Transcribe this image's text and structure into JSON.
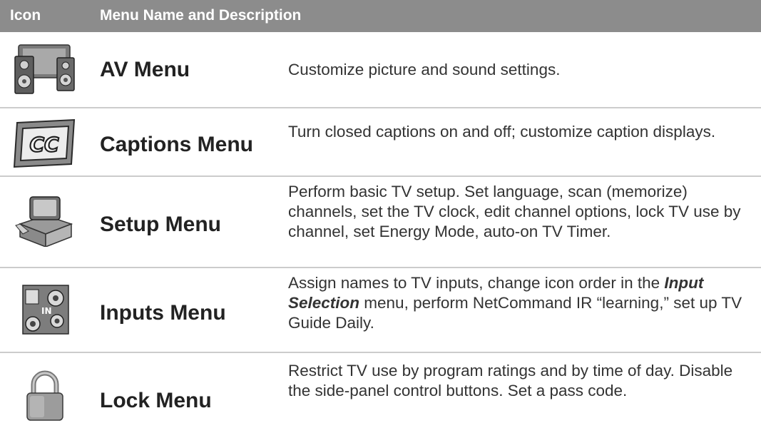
{
  "header": {
    "col_icon": "Icon",
    "col_menu": "Menu Name and Description"
  },
  "rows": [
    {
      "icon": "av-speakers-icon",
      "name": "AV Menu",
      "desc": "Customize picture and sound settings."
    },
    {
      "icon": "cc-icon",
      "icon_text": "CC",
      "name": "Captions Menu",
      "desc": "Turn closed captions on and off; customize caption displays."
    },
    {
      "icon": "tv-box-icon",
      "name": "Setup Menu",
      "desc": "Perform basic TV setup.  Set language, scan (memorize) channels, set the TV clock, edit channel options, lock TV use by channel, set Energy Mode, auto-on TV Timer."
    },
    {
      "icon": "input-jacks-icon",
      "icon_text": "IN",
      "name": "Inputs Menu",
      "desc_part1": "Assign names to TV inputs, change icon order in the ",
      "desc_em": "Input Selection",
      "desc_part2": " menu, perform NetCommand IR “learning,” set up TV Guide Daily."
    },
    {
      "icon": "padlock-icon",
      "name": "Lock Menu",
      "desc": "Restrict TV use by program ratings and by time of day.  Disable the side-panel control buttons.  Set a pass code."
    }
  ]
}
